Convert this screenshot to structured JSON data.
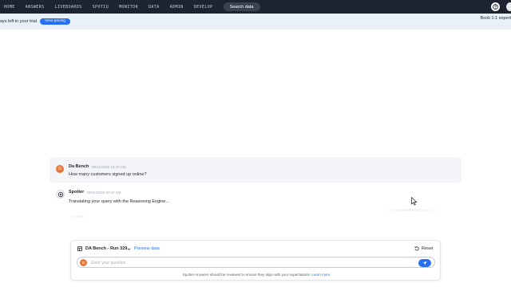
{
  "nav": {
    "items": [
      "HOME",
      "ANSWERS",
      "LIVEBOARDS",
      "SPOTIQ",
      "MONITOR",
      "DATA",
      "ADMIN",
      "DEVELOP"
    ],
    "search_label": "Search data",
    "help_icon": "question-icon"
  },
  "banner": {
    "trial_text": "ays left in your trial.",
    "pricing_button": "View pricing",
    "right_text": "Book 1:1 expert"
  },
  "chat": {
    "user_message": {
      "avatar_letter": "D",
      "name": "Da Bench",
      "time": "09/11/2025 10:47 AM",
      "text": "How many customers signed up online?"
    },
    "bot_message": {
      "name": "Spotter",
      "time": "09/11/2025 10:47 AM",
      "text": "Translating your query with the Reasoning Engine..."
    }
  },
  "composer": {
    "dataset": "DA Bench - Run 329",
    "preview_label": "Preview data",
    "reset_label": "Reset",
    "avatar_letter": "D",
    "placeholder": "Enter your question",
    "disclaimer": "Spotter Answers should be reviewed to ensure they align with your expectations.",
    "learn_more": "Learn more"
  },
  "colors": {
    "nav_bg": "#1d232f",
    "accent": "#2770ef",
    "avatar": "#e8763a",
    "banner_bg": "#eaf0f8"
  }
}
